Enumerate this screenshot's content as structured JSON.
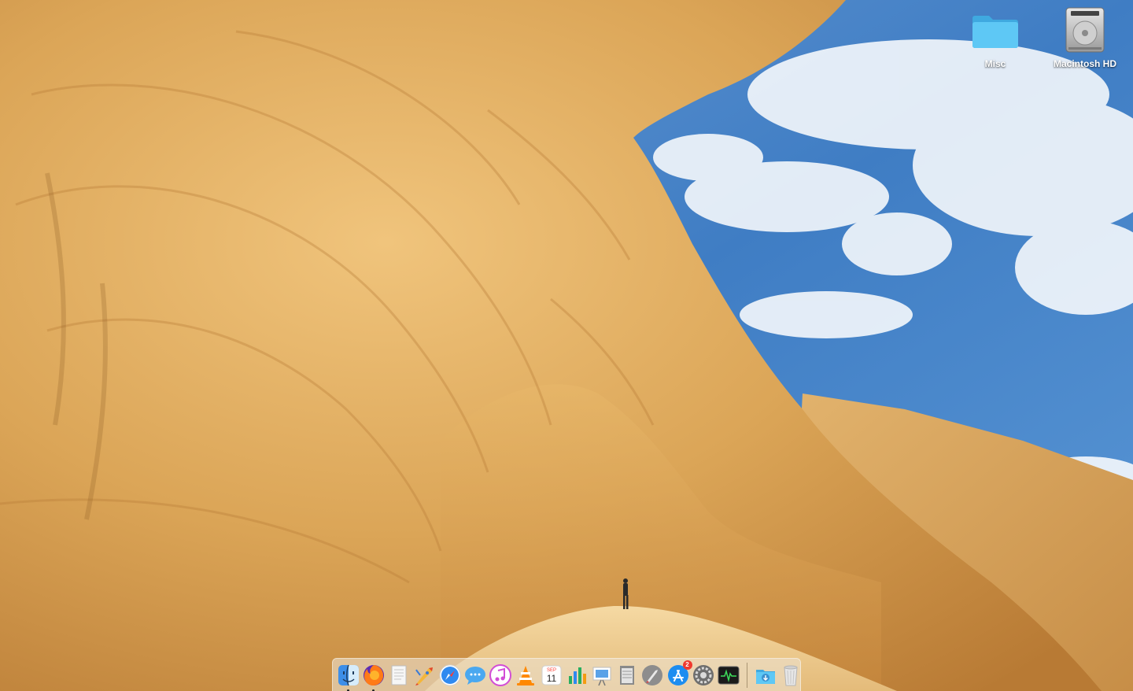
{
  "desktop": {
    "icons": [
      {
        "label": "Misc",
        "icon": "folder-icon"
      },
      {
        "label": "Macintosh HD",
        "icon": "hard-drive-icon"
      }
    ]
  },
  "dock": {
    "apps": [
      {
        "icon": "finder-icon",
        "running": true
      },
      {
        "icon": "firefox-icon",
        "running": true
      },
      {
        "icon": "textedit-icon",
        "running": false
      },
      {
        "icon": "rocket-icon",
        "running": false
      },
      {
        "icon": "safari-icon",
        "running": false
      },
      {
        "icon": "messages-icon",
        "running": false
      },
      {
        "icon": "itunes-icon",
        "running": false
      },
      {
        "icon": "vlc-icon",
        "running": false
      },
      {
        "icon": "calendar-icon",
        "running": false,
        "month": "SEP",
        "day": "11"
      },
      {
        "icon": "numbers-icon",
        "running": false
      },
      {
        "icon": "keynote-icon",
        "running": false
      },
      {
        "icon": "notes-icon",
        "running": false
      },
      {
        "icon": "launchpad-icon",
        "running": false
      },
      {
        "icon": "app-store-icon",
        "running": false,
        "badge": "2"
      },
      {
        "icon": "system-preferences-icon",
        "running": false
      },
      {
        "icon": "activity-monitor-icon",
        "running": false
      }
    ],
    "trailing": [
      {
        "icon": "downloads-folder-icon"
      },
      {
        "icon": "trash-icon"
      }
    ]
  },
  "colors": {
    "folder": "#5ec8f5",
    "dock_bg": "#ebe1cd",
    "badge": "#f03a2e",
    "sky": "#4a86c8",
    "rock": "#e0aa5a"
  }
}
